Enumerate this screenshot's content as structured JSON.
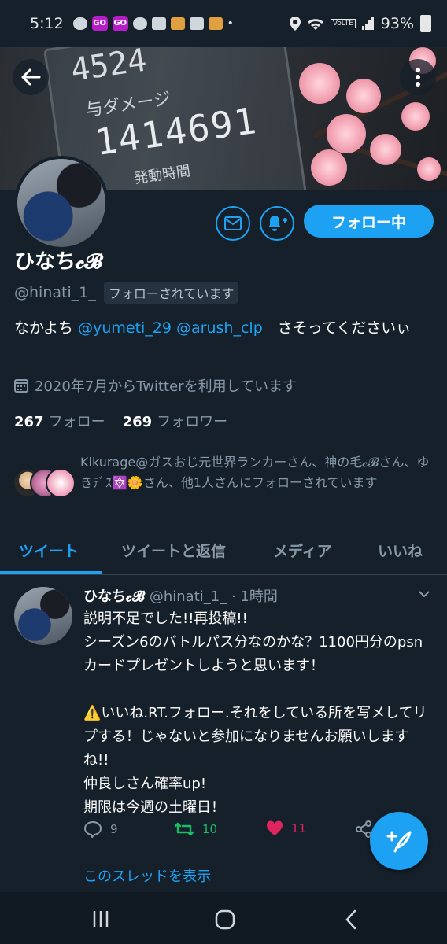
{
  "status_bar": {
    "time": "5:12",
    "battery": "93%",
    "go_label": "GO"
  },
  "banner": {
    "number_top": "4524",
    "label": "与ダメージ",
    "number_main": "1414691",
    "label2": "発動時間"
  },
  "profile": {
    "name": "ひなち𝓬𝓑",
    "handle": "@hinati_1_",
    "follows_you": "フォローされています",
    "bio_prefix": "なかよち ",
    "bio_mention1": "@yumeti_29",
    "bio_mention2": "@arush_clp",
    "bio_suffix": "　さそってくださいぃ",
    "joined": "2020年7月からTwitterを利用しています",
    "following_count": "267",
    "following_label": "フォロー",
    "followers_count": "269",
    "followers_label": "フォロワー",
    "followed_by": "Kikurage@ガスおじ元世界ランカーさん、神の毛𝓬𝓑さん、ゆきﾃﾞｽ🔯🌼さん、他1人さんにフォローされています",
    "follow_button": "フォロー中"
  },
  "tabs": [
    "ツイート",
    "ツイートと返信",
    "メディア",
    "いいね"
  ],
  "tweet": {
    "name": "ひなち𝓬𝓑",
    "handle": "@hinati_1_",
    "time": "· 1時間",
    "text": "説明不足でした!!再投稿!!\nシーズン6のバトルパス分なのかな？1100円分のpsnカードプレゼントしようと思います！\n\n⚠️いいね.RT.フォロー.それをしている所を写メしてリプする！じゃないと参加になりませんお願いしますね!!\n仲良しさん確率up!\n期限は今週の土曜日！",
    "reply_count": "9",
    "retweet_count": "10",
    "like_count": "11",
    "thread_link": "このスレッドを表示"
  },
  "colors": {
    "accent": "#1da1f2",
    "background": "#15202b",
    "retweet": "#17bf63",
    "like": "#e0245e"
  }
}
